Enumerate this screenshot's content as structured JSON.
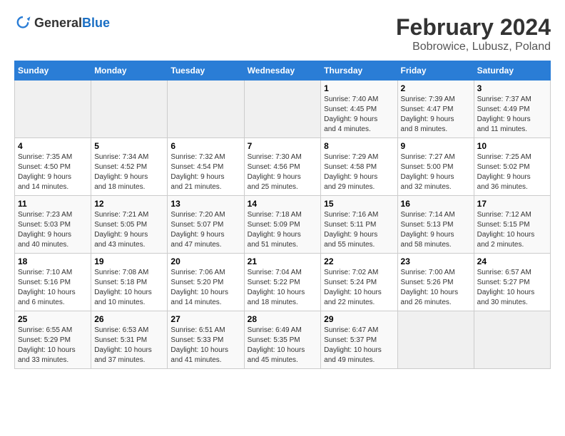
{
  "header": {
    "logo_general": "General",
    "logo_blue": "Blue",
    "title": "February 2024",
    "location": "Bobrowice, Lubusz, Poland"
  },
  "columns": [
    "Sunday",
    "Monday",
    "Tuesday",
    "Wednesday",
    "Thursday",
    "Friday",
    "Saturday"
  ],
  "weeks": [
    [
      {
        "day": "",
        "info": ""
      },
      {
        "day": "",
        "info": ""
      },
      {
        "day": "",
        "info": ""
      },
      {
        "day": "",
        "info": ""
      },
      {
        "day": "1",
        "info": "Sunrise: 7:40 AM\nSunset: 4:45 PM\nDaylight: 9 hours\nand 4 minutes."
      },
      {
        "day": "2",
        "info": "Sunrise: 7:39 AM\nSunset: 4:47 PM\nDaylight: 9 hours\nand 8 minutes."
      },
      {
        "day": "3",
        "info": "Sunrise: 7:37 AM\nSunset: 4:49 PM\nDaylight: 9 hours\nand 11 minutes."
      }
    ],
    [
      {
        "day": "4",
        "info": "Sunrise: 7:35 AM\nSunset: 4:50 PM\nDaylight: 9 hours\nand 14 minutes."
      },
      {
        "day": "5",
        "info": "Sunrise: 7:34 AM\nSunset: 4:52 PM\nDaylight: 9 hours\nand 18 minutes."
      },
      {
        "day": "6",
        "info": "Sunrise: 7:32 AM\nSunset: 4:54 PM\nDaylight: 9 hours\nand 21 minutes."
      },
      {
        "day": "7",
        "info": "Sunrise: 7:30 AM\nSunset: 4:56 PM\nDaylight: 9 hours\nand 25 minutes."
      },
      {
        "day": "8",
        "info": "Sunrise: 7:29 AM\nSunset: 4:58 PM\nDaylight: 9 hours\nand 29 minutes."
      },
      {
        "day": "9",
        "info": "Sunrise: 7:27 AM\nSunset: 5:00 PM\nDaylight: 9 hours\nand 32 minutes."
      },
      {
        "day": "10",
        "info": "Sunrise: 7:25 AM\nSunset: 5:02 PM\nDaylight: 9 hours\nand 36 minutes."
      }
    ],
    [
      {
        "day": "11",
        "info": "Sunrise: 7:23 AM\nSunset: 5:03 PM\nDaylight: 9 hours\nand 40 minutes."
      },
      {
        "day": "12",
        "info": "Sunrise: 7:21 AM\nSunset: 5:05 PM\nDaylight: 9 hours\nand 43 minutes."
      },
      {
        "day": "13",
        "info": "Sunrise: 7:20 AM\nSunset: 5:07 PM\nDaylight: 9 hours\nand 47 minutes."
      },
      {
        "day": "14",
        "info": "Sunrise: 7:18 AM\nSunset: 5:09 PM\nDaylight: 9 hours\nand 51 minutes."
      },
      {
        "day": "15",
        "info": "Sunrise: 7:16 AM\nSunset: 5:11 PM\nDaylight: 9 hours\nand 55 minutes."
      },
      {
        "day": "16",
        "info": "Sunrise: 7:14 AM\nSunset: 5:13 PM\nDaylight: 9 hours\nand 58 minutes."
      },
      {
        "day": "17",
        "info": "Sunrise: 7:12 AM\nSunset: 5:15 PM\nDaylight: 10 hours\nand 2 minutes."
      }
    ],
    [
      {
        "day": "18",
        "info": "Sunrise: 7:10 AM\nSunset: 5:16 PM\nDaylight: 10 hours\nand 6 minutes."
      },
      {
        "day": "19",
        "info": "Sunrise: 7:08 AM\nSunset: 5:18 PM\nDaylight: 10 hours\nand 10 minutes."
      },
      {
        "day": "20",
        "info": "Sunrise: 7:06 AM\nSunset: 5:20 PM\nDaylight: 10 hours\nand 14 minutes."
      },
      {
        "day": "21",
        "info": "Sunrise: 7:04 AM\nSunset: 5:22 PM\nDaylight: 10 hours\nand 18 minutes."
      },
      {
        "day": "22",
        "info": "Sunrise: 7:02 AM\nSunset: 5:24 PM\nDaylight: 10 hours\nand 22 minutes."
      },
      {
        "day": "23",
        "info": "Sunrise: 7:00 AM\nSunset: 5:26 PM\nDaylight: 10 hours\nand 26 minutes."
      },
      {
        "day": "24",
        "info": "Sunrise: 6:57 AM\nSunset: 5:27 PM\nDaylight: 10 hours\nand 30 minutes."
      }
    ],
    [
      {
        "day": "25",
        "info": "Sunrise: 6:55 AM\nSunset: 5:29 PM\nDaylight: 10 hours\nand 33 minutes."
      },
      {
        "day": "26",
        "info": "Sunrise: 6:53 AM\nSunset: 5:31 PM\nDaylight: 10 hours\nand 37 minutes."
      },
      {
        "day": "27",
        "info": "Sunrise: 6:51 AM\nSunset: 5:33 PM\nDaylight: 10 hours\nand 41 minutes."
      },
      {
        "day": "28",
        "info": "Sunrise: 6:49 AM\nSunset: 5:35 PM\nDaylight: 10 hours\nand 45 minutes."
      },
      {
        "day": "29",
        "info": "Sunrise: 6:47 AM\nSunset: 5:37 PM\nDaylight: 10 hours\nand 49 minutes."
      },
      {
        "day": "",
        "info": ""
      },
      {
        "day": "",
        "info": ""
      }
    ]
  ]
}
